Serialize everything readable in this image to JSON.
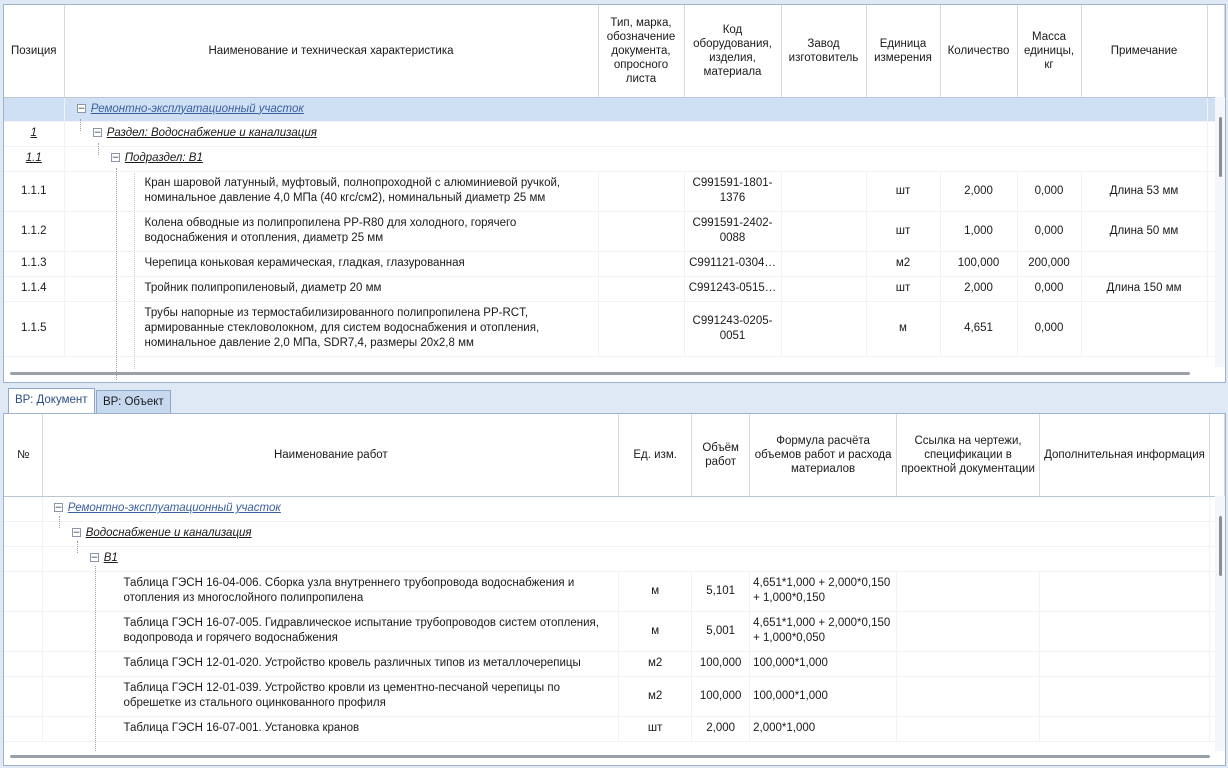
{
  "spec": {
    "columns": [
      "Позиция",
      "Наименование и техническая характеристика",
      "Тип, марка, обозначение документа, опросного листа",
      "Код оборудования, изделия, материала",
      "Завод изготовитель",
      "Единица измерения",
      "Количество",
      "Масса единицы, кг",
      "Примечание"
    ],
    "group_label": "Ремонтно-эксплуатационный участок",
    "section": {
      "pos": "1",
      "label": "Раздел: Водоснабжение и канализация"
    },
    "subsection": {
      "pos": "1.1",
      "label": "Подраздел: В1"
    },
    "rows": [
      {
        "pos": "1.1.1",
        "name": "Кран шаровой латунный, муфтовый, полнопроходной с алюминиевой ручкой, номинальное давление 4,0 МПа (40 кгс/см2), номинальный диаметр 25 мм",
        "code": "С991591-1801-1376",
        "unit": "шт",
        "qty": "2,000",
        "mass": "0,000",
        "note": "Длина 53 мм"
      },
      {
        "pos": "1.1.2",
        "name": "Колена обводные из полипропилена PP-R80 для холодного, горячего водоснабжения и отопления, диаметр 25 мм",
        "code": "С991591-2402-0088",
        "unit": "шт",
        "qty": "1,000",
        "mass": "0,000",
        "note": "Длина 50 мм"
      },
      {
        "pos": "1.1.3",
        "name": "Черепица коньковая керамическая, гладкая, глазурованная",
        "code": "С991121-0304…",
        "unit": "м2",
        "qty": "100,000",
        "mass": "200,000",
        "note": ""
      },
      {
        "pos": "1.1.4",
        "name": "Тройник полипропиленовый, диаметр 20 мм",
        "code": "С991243-0515…",
        "unit": "шт",
        "qty": "2,000",
        "mass": "0,000",
        "note": "Длина 150 мм"
      },
      {
        "pos": "1.1.5",
        "name": "Трубы напорные из термостабилизированного полипропилена PP-RCT, армированные стекловолокном, для систем водоснабжения и отопления, номинальное давление 2,0 МПа, SDR7,4, размеры 20х2,8 мм",
        "code": "С991243-0205-0051",
        "unit": "м",
        "qty": "4,651",
        "mass": "0,000",
        "note": ""
      }
    ]
  },
  "tabs": [
    "ВР: Документ",
    "ВР: Объект"
  ],
  "works": {
    "columns": [
      "№",
      "Наименование работ",
      "Ед. изм.",
      "Объём работ",
      "Формула расчёта объемов работ и расхода материалов",
      "Ссылка на чертежи, спецификации в проектной документации",
      "Дополнительная информация"
    ],
    "group_label": "Ремонтно-эксплуатационный участок",
    "section_label": "Водоснабжение и канализация",
    "subsection_label": "В1",
    "rows": [
      {
        "name": "Таблица ГЭСН 16-04-006. Сборка узла внутреннего трубопровода водоснабжения и отопления из многослойного полипропилена",
        "unit": "м",
        "volume": "5,101",
        "formula": "4,651*1,000 + 2,000*0,150 + 1,000*0,150"
      },
      {
        "name": "Таблица ГЭСН 16-07-005. Гидравлическое испытание трубопроводов систем отопления, водопровода и горячего водоснабжения",
        "unit": "м",
        "volume": "5,001",
        "formula": "4,651*1,000 + 2,000*0,150 + 1,000*0,050"
      },
      {
        "name": "Таблица ГЭСН 12-01-020. Устройство кровель различных типов из металлочерепицы",
        "unit": "м2",
        "volume": "100,000",
        "formula": "100,000*1,000"
      },
      {
        "name": "Таблица ГЭСН 12-01-039. Устройство кровли из цементно-песчаной черепицы по обрешетке из стального оцинкованного профиля",
        "unit": "м2",
        "volume": "100,000",
        "formula": "100,000*1,000"
      },
      {
        "name": "Таблица ГЭСН 16-07-001. Установка кранов",
        "unit": "шт",
        "volume": "2,000",
        "formula": "2,000*1,000"
      }
    ]
  }
}
